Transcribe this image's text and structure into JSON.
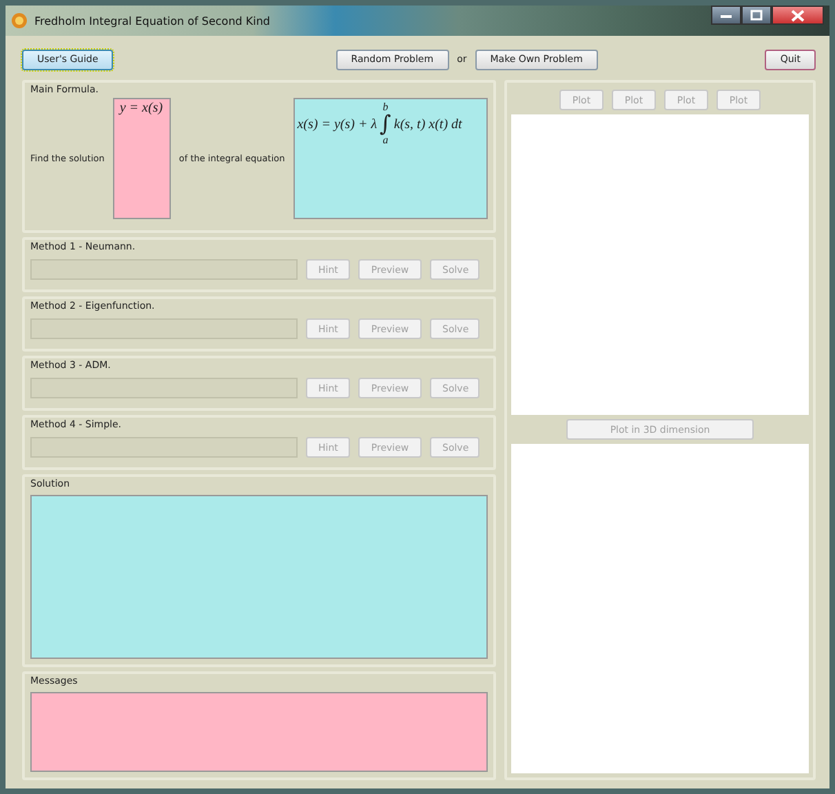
{
  "window": {
    "title": "Fredholm Integral Equation of Second Kind"
  },
  "toolbar": {
    "users_guide": {
      "label": "User's Guide",
      "focused": true
    },
    "random": {
      "label": "Random Problem"
    },
    "or": "or",
    "own": {
      "label": "Make Own Problem"
    },
    "quit": {
      "label": "Quit"
    }
  },
  "main_formula": {
    "title": "Main Formula.",
    "find": "Find the solution",
    "solution_formula": "y = x(s)",
    "of": "of the integral equation",
    "equation": {
      "lhs": "x(s) = y(s) + λ",
      "integral": "∫",
      "upper": "b",
      "lower": "a",
      "rhs": "k(s, t) x(t) dt"
    }
  },
  "methods": [
    {
      "title": "Method 1 - Neumann.",
      "buttons": [
        {
          "label": "Hint",
          "disabled": true
        },
        {
          "label": "Preview",
          "disabled": true
        },
        {
          "label": "Solve",
          "disabled": true
        }
      ]
    },
    {
      "title": "Method 2 - Eigenfunction.",
      "buttons": [
        {
          "label": "Hint",
          "disabled": true
        },
        {
          "label": "Preview",
          "disabled": true
        },
        {
          "label": "Solve",
          "disabled": true
        }
      ]
    },
    {
      "title": "Method 3 - ADM.",
      "buttons": [
        {
          "label": "Hint",
          "disabled": true
        },
        {
          "label": "Preview",
          "disabled": true
        },
        {
          "label": "Solve",
          "disabled": true
        }
      ]
    },
    {
      "title": "Method 4 - Simple.",
      "buttons": [
        {
          "label": "Hint",
          "disabled": true
        },
        {
          "label": "Preview",
          "disabled": true
        },
        {
          "label": "Solve",
          "disabled": true
        }
      ]
    }
  ],
  "solution": {
    "title": "Solution"
  },
  "messages": {
    "title": "Messages"
  },
  "plots": {
    "buttons": [
      {
        "label": "Plot",
        "disabled": true
      },
      {
        "label": "Plot",
        "disabled": true
      },
      {
        "label": "Plot",
        "disabled": true
      },
      {
        "label": "Plot",
        "disabled": true
      }
    ],
    "plot_3d": {
      "label": "Plot in 3D dimension",
      "disabled": true
    }
  }
}
